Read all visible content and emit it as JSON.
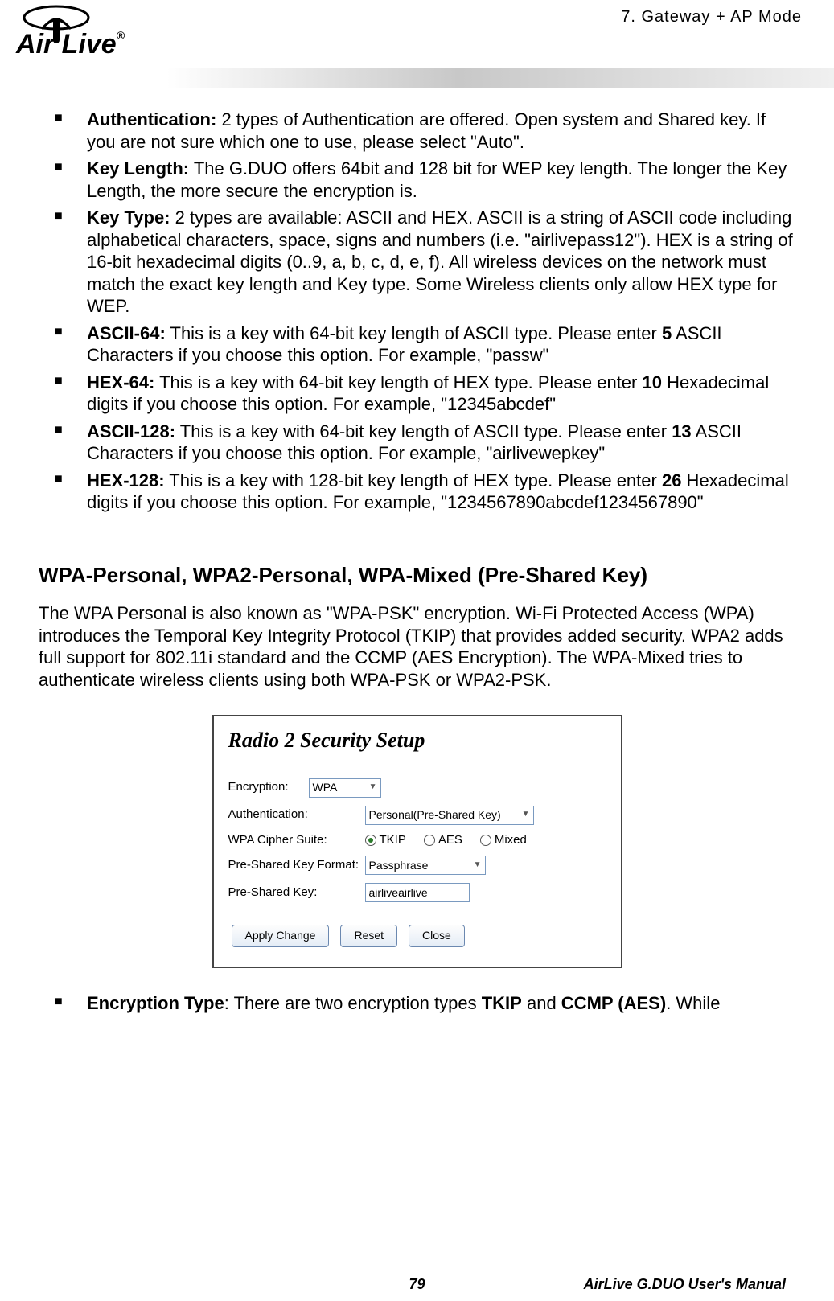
{
  "header": {
    "breadcrumb": "7.  Gateway  +  AP    Mode",
    "logo_text": "Air Live",
    "logo_r": "®"
  },
  "bullets_top": [
    {
      "label": "Authentication:",
      "text": "   2 types of Authentication are offered.    Open system and Shared key.    If you are not sure which one to use, please select \"Auto\"."
    },
    {
      "label": "Key Length:",
      "text": "   The G.DUO offers 64bit and 128 bit for WEP key length.    The longer the Key Length, the more secure the encryption is."
    },
    {
      "label": "Key Type:",
      "text": "   2 types are available: ASCII and HEX.    ASCII is a string of ASCII code including alphabetical characters, space, signs and numbers (i.e. \"airlivepass12\").    HEX is a string of 16-bit hexadecimal digits (0..9, a, b, c, d, e, f).  All wireless devices on the network must match the exact key length and Key type.  Some Wireless clients only allow HEX type for WEP."
    },
    {
      "label": "ASCII-64:",
      "text_before": " This is a key with 64-bit key length of ASCII type.    Please enter ",
      "bold_mid": "5",
      "text_after": " ASCII Characters if you choose this option. For example, \"passw\""
    },
    {
      "label": "HEX-64:",
      "text_before": " This is a key with 64-bit key length of HEX type.    Please enter ",
      "bold_mid": "10",
      "text_after": " Hexadecimal digits if you choose this option. For example, \"12345abcdef\""
    },
    {
      "label": "ASCII-128:",
      "text_before": " This is a key with 64-bit key length of ASCII type.    Please enter ",
      "bold_mid": "13",
      "text_after": " ASCII Characters if you choose this option. For example, \"airlivewepkey\""
    },
    {
      "label": "HEX-128:",
      "text_before": " This is a key with 128-bit key length of HEX type.    Please enter ",
      "bold_mid": "26",
      "text_after": " Hexadecimal digits if you choose this option. For example, \"1234567890abcdef1234567890\""
    }
  ],
  "section": {
    "heading": "WPA-Personal, WPA2-Personal, WPA-Mixed (Pre-Shared Key)",
    "intro": "The WPA Personal is also known as \"WPA-PSK\" encryption.    Wi-Fi Protected Access (WPA) introduces the Temporal Key Integrity Protocol (TKIP) that provides added security.    WPA2 adds full support for 802.11i standard and the CCMP (AES Encryption).  The WPA-Mixed tries to authenticate wireless clients using both WPA-PSK or WPA2-PSK."
  },
  "dialog": {
    "title": "Radio 2 Security Setup",
    "rows": {
      "encryption_label": "Encryption:",
      "encryption_value": "WPA",
      "auth_label": "Authentication:",
      "auth_value": "Personal(Pre-Shared Key)",
      "cipher_label": "WPA Cipher Suite:",
      "cipher_options": {
        "tkip": "TKIP",
        "aes": "AES",
        "mixed": "Mixed"
      },
      "psk_format_label": "Pre-Shared Key Format:",
      "psk_format_value": "Passphrase",
      "psk_label": "Pre-Shared Key:",
      "psk_value": "airliveairlive"
    },
    "buttons": {
      "apply": "Apply Change",
      "reset": "Reset",
      "close": "Close"
    }
  },
  "last_bullet": {
    "label": "Encryption Type",
    "colon": ":",
    "text_before": "   There are two encryption types ",
    "b1": "TKIP",
    "mid": " and ",
    "b2": "CCMP (AES)",
    "after": ". While"
  },
  "footer": {
    "page_number": "79",
    "manual": "AirLive  G.DUO  User's  Manual"
  }
}
